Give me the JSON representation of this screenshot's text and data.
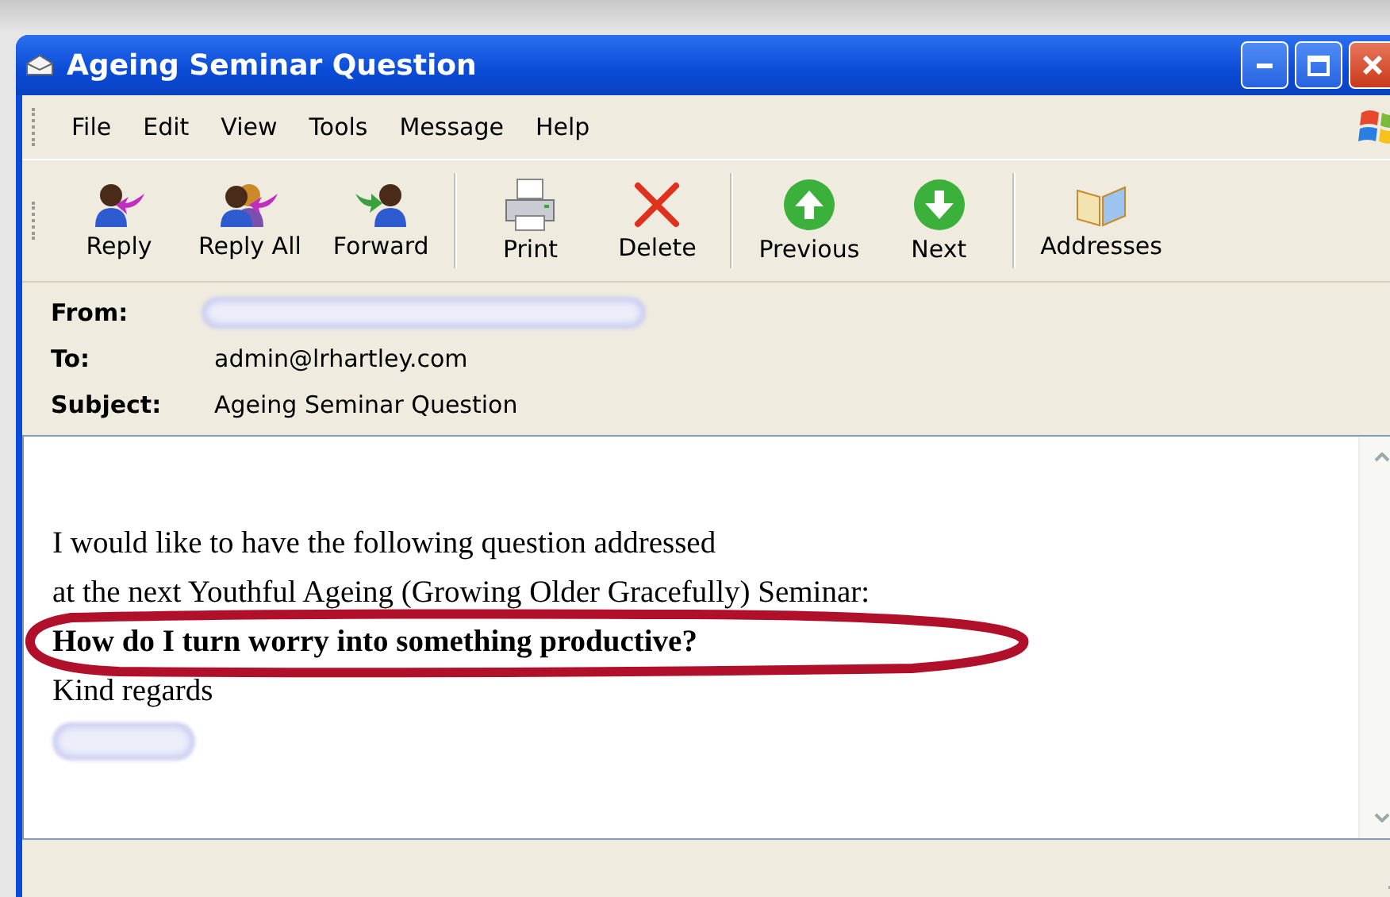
{
  "window": {
    "title": "Ageing Seminar Question"
  },
  "menu": [
    "File",
    "Edit",
    "View",
    "Tools",
    "Message",
    "Help"
  ],
  "toolbar": [
    {
      "label": "Reply",
      "kind": "reply",
      "separator_after": false
    },
    {
      "label": "Reply All",
      "kind": "replyall",
      "separator_after": false
    },
    {
      "label": "Forward",
      "kind": "forward",
      "separator_after": true
    },
    {
      "label": "Print",
      "kind": "print",
      "separator_after": false
    },
    {
      "label": "Delete",
      "kind": "delete",
      "separator_after": true
    },
    {
      "label": "Previous",
      "kind": "previous",
      "separator_after": false
    },
    {
      "label": "Next",
      "kind": "next",
      "separator_after": true
    },
    {
      "label": "Addresses",
      "kind": "addresses",
      "separator_after": false
    }
  ],
  "header": [
    {
      "label": "From:",
      "redacted": true
    },
    {
      "label": "To:",
      "value": "admin@lrhartley.com",
      "redacted": false
    },
    {
      "label": "Subject:",
      "value": "Ageing Seminar Question",
      "redacted": false
    }
  ],
  "body": [
    {
      "text": "I would like to have the following question addressed",
      "kind": "plain"
    },
    {
      "text": "at the next Youthful Ageing (Growing Older Gracefully) Seminar:",
      "kind": "plain"
    },
    {
      "text": "How do I turn worry into something productive?",
      "kind": "bold"
    },
    {
      "text": "Kind regards",
      "kind": "plain"
    },
    {
      "kind": "redacted"
    }
  ]
}
